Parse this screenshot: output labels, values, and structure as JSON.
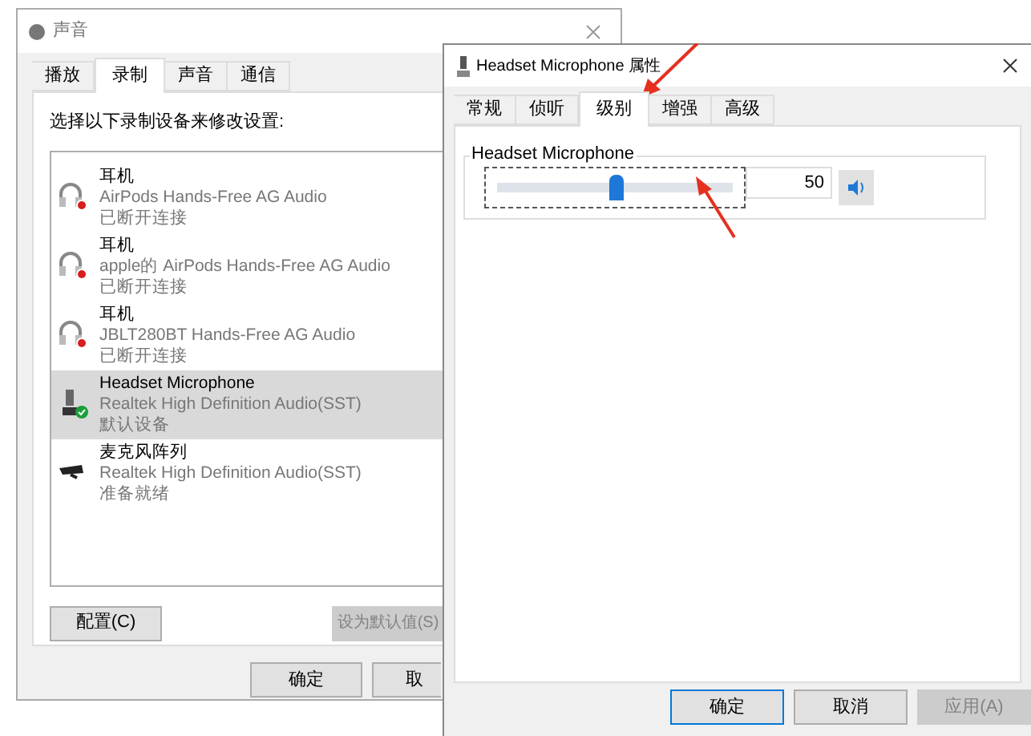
{
  "sound_window": {
    "title": "声音",
    "tabs": [
      {
        "label": "播放",
        "selected": false
      },
      {
        "label": "录制",
        "selected": true
      },
      {
        "label": "声音",
        "selected": false
      },
      {
        "label": "通信",
        "selected": false
      }
    ],
    "instruction": "选择以下录制设备来修改设置:",
    "devices": [
      {
        "name": "耳机",
        "driver": "AirPods Hands-Free AG Audio",
        "status": "已断开连接",
        "kind": "headphones",
        "connected": false,
        "default": false,
        "selected": false
      },
      {
        "name": "耳机",
        "driver": "apple的 AirPods Hands-Free AG Audio",
        "status": "已断开连接",
        "kind": "headphones",
        "connected": false,
        "default": false,
        "selected": false
      },
      {
        "name": "耳机",
        "driver": "JBLT280BT Hands-Free AG Audio",
        "status": "已断开连接",
        "kind": "headphones",
        "connected": false,
        "default": false,
        "selected": false
      },
      {
        "name": "Headset Microphone",
        "driver": "Realtek High Definition Audio(SST)",
        "status": "默认设备",
        "kind": "microphone",
        "connected": true,
        "default": true,
        "selected": true
      },
      {
        "name": "麦克风阵列",
        "driver": "Realtek High Definition Audio(SST)",
        "status": "准备就绪",
        "kind": "mic-array",
        "connected": true,
        "default": false,
        "selected": false
      }
    ],
    "configure_button": "配置(C)",
    "set_default_button": {
      "label": "设为默认值(S)",
      "disabled": true
    },
    "buttons": [
      {
        "label": "确定"
      },
      {
        "label": "取"
      }
    ]
  },
  "properties_window": {
    "title": "Headset Microphone 属性",
    "tabs": [
      {
        "label": "常规",
        "selected": false
      },
      {
        "label": "侦听",
        "selected": false
      },
      {
        "label": "级别",
        "selected": true
      },
      {
        "label": "增强",
        "selected": false
      },
      {
        "label": "高级",
        "selected": false
      }
    ],
    "group_title": "Headset Microphone",
    "slider": {
      "level": 0.5
    },
    "value": "50",
    "buttons": [
      {
        "label": "确定",
        "default": true,
        "disabled": false
      },
      {
        "label": "取消",
        "default": false,
        "disabled": false
      },
      {
        "label": "应用(A)",
        "default": false,
        "disabled": true
      }
    ]
  }
}
